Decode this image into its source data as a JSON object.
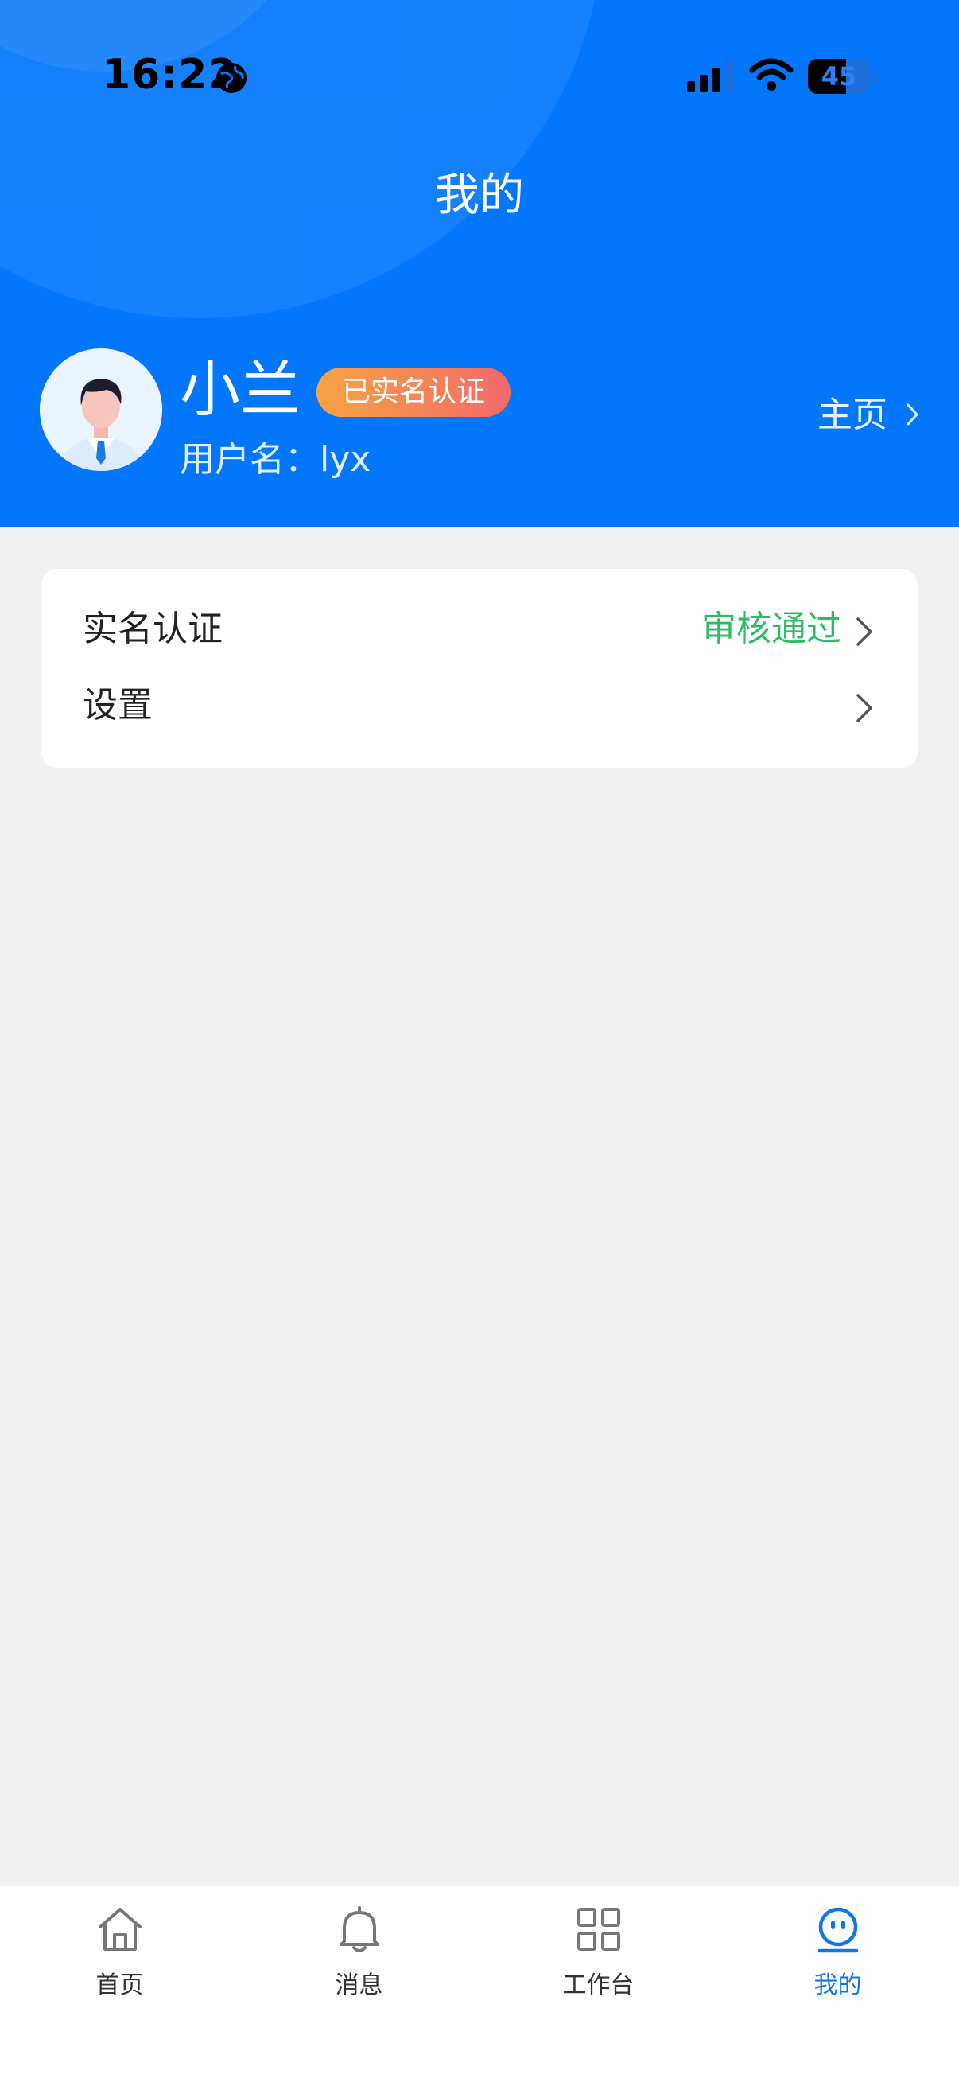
{
  "status_bar": {
    "time": "16:22",
    "battery": "45"
  },
  "header": {
    "title": "我的"
  },
  "profile": {
    "name": "小兰",
    "badge": "已实名认证",
    "username_label": "用户名：",
    "username": "lyx",
    "home_link": "主页"
  },
  "menu": [
    {
      "label": "实名认证",
      "value": "审核通过"
    },
    {
      "label": "设置",
      "value": ""
    }
  ],
  "tabs": [
    {
      "label": "首页",
      "icon": "home-icon"
    },
    {
      "label": "消息",
      "icon": "bell-icon"
    },
    {
      "label": "工作台",
      "icon": "grid-icon"
    },
    {
      "label": "我的",
      "icon": "profile-icon",
      "active": true
    }
  ],
  "colors": {
    "primary": "#0377fb",
    "success": "#2fba65",
    "tab_active": "#1177e8"
  }
}
